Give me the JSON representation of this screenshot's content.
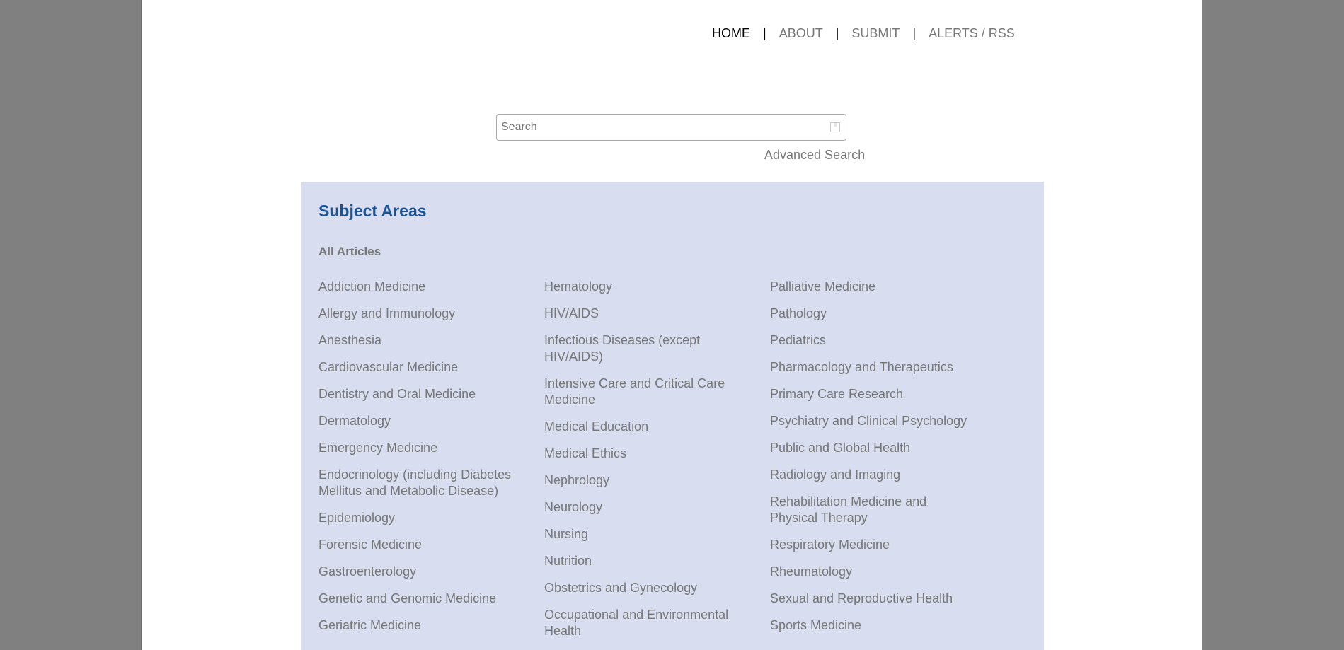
{
  "nav": {
    "items": [
      {
        "label": "HOME"
      },
      {
        "label": "ABOUT"
      },
      {
        "label": "SUBMIT"
      },
      {
        "label": "ALERTS / RSS"
      }
    ],
    "separator": "|"
  },
  "search": {
    "placeholder": "Search",
    "value": "",
    "advanced_label": "Advanced Search"
  },
  "subjects": {
    "title": "Subject Areas",
    "all_articles": "All Articles",
    "columns": [
      [
        "Addiction Medicine",
        "Allergy and Immunology",
        "Anesthesia",
        "Cardiovascular Medicine",
        "Dentistry and Oral Medicine",
        "Dermatology",
        "Emergency Medicine",
        "Endocrinology (including Diabetes Mellitus and Metabolic Disease)",
        "Epidemiology",
        "Forensic Medicine",
        "Gastroenterology",
        "Genetic and Genomic Medicine",
        "Geriatric Medicine"
      ],
      [
        "Hematology",
        "HIV/AIDS",
        "Infectious Diseases (except HIV/AIDS)",
        "Intensive Care and Critical Care Medicine",
        "Medical Education",
        "Medical Ethics",
        "Nephrology",
        "Neurology",
        "Nursing",
        "Nutrition",
        "Obstetrics and Gynecology",
        "Occupational and Environmental Health"
      ],
      [
        "Palliative Medicine",
        "Pathology",
        "Pediatrics",
        "Pharmacology and Therapeutics",
        "Primary Care Research",
        "Psychiatry and Clinical Psychology",
        "Public and Global Health",
        "Radiology and Imaging",
        "Rehabilitation Medicine and Physical Therapy",
        "Respiratory Medicine",
        "Rheumatology",
        "Sexual and Reproductive Health",
        "Sports Medicine"
      ]
    ]
  },
  "colors": {
    "title": "#1a5498",
    "panel": "#d8def0",
    "link": "#777777",
    "backdrop": "#808080"
  }
}
